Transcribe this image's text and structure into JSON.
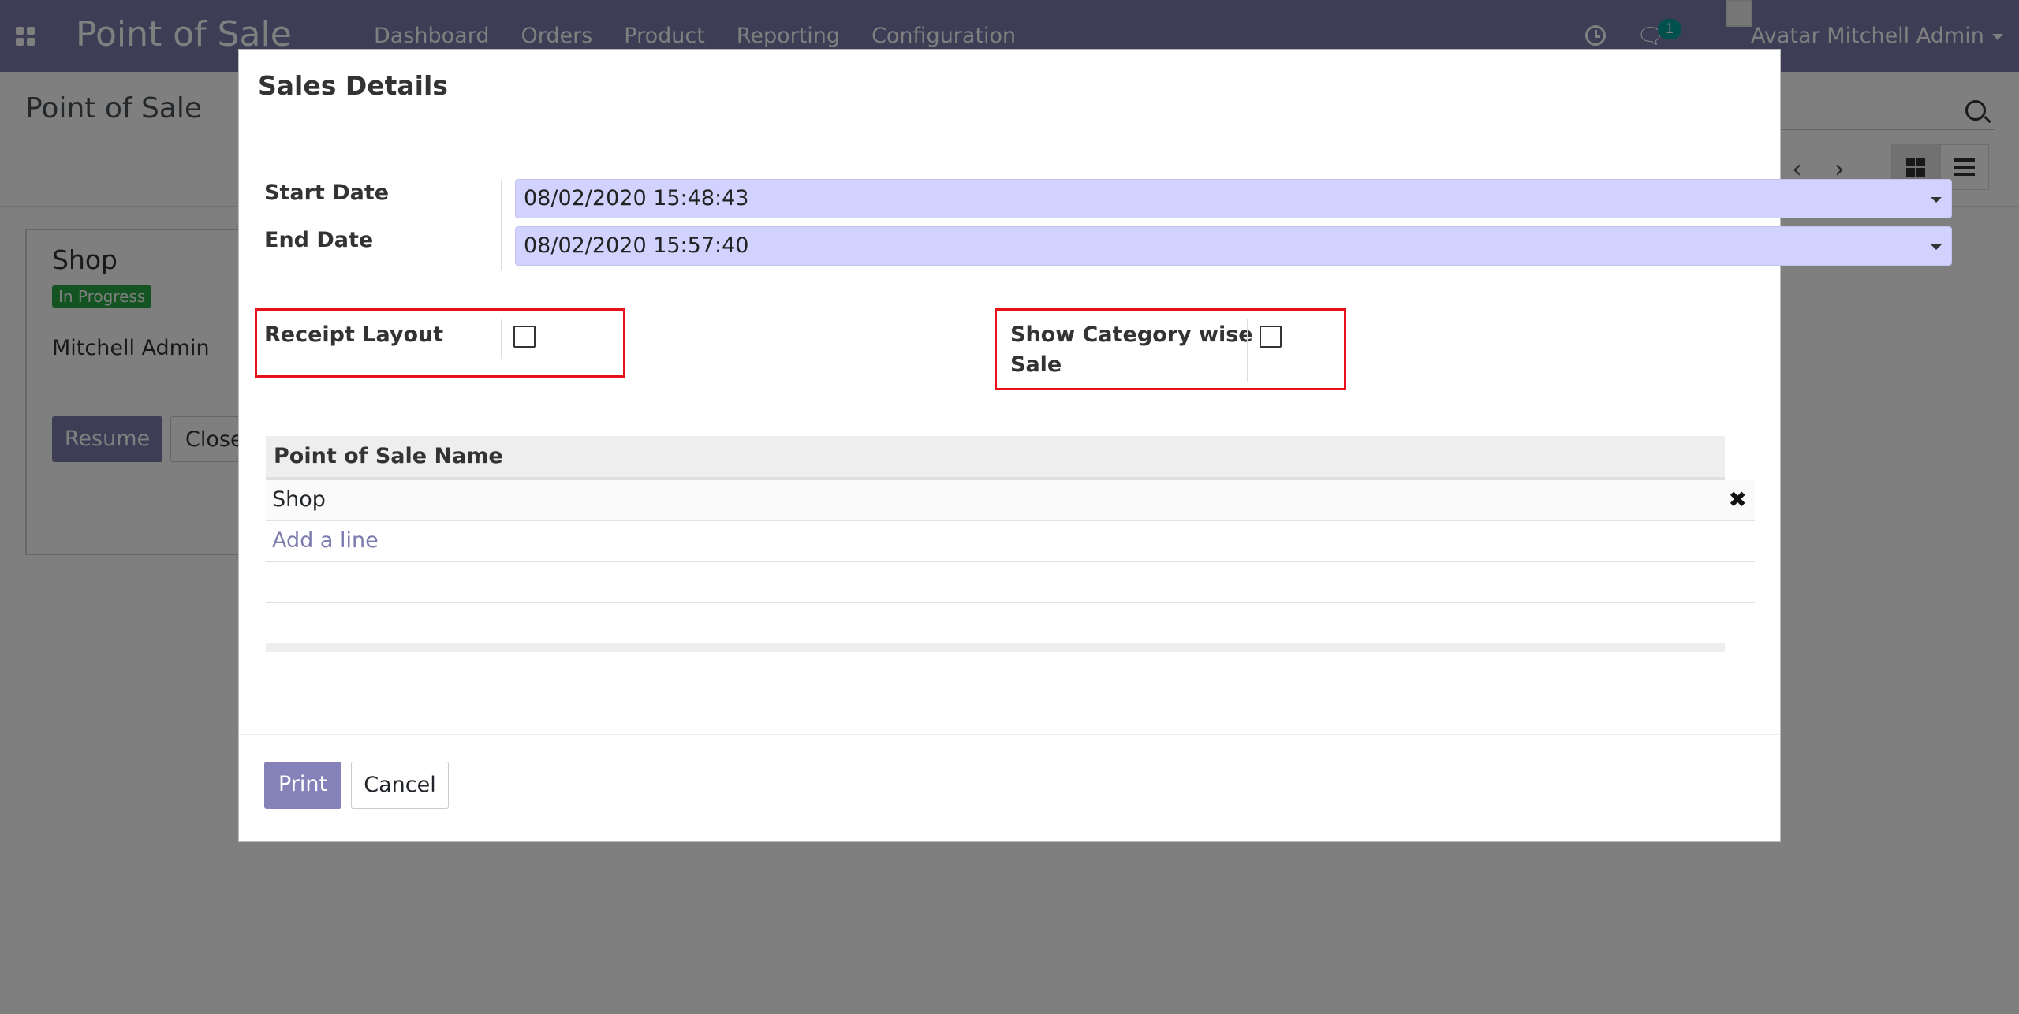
{
  "navbar": {
    "brand": "Point of Sale",
    "menu": [
      "Dashboard",
      "Orders",
      "Product",
      "Reporting",
      "Configuration"
    ],
    "chat_count": "1",
    "user": "Avatar Mitchell Admin",
    "icons": [
      "apps-icon",
      "clock-icon",
      "chat-icon",
      "avatar-image"
    ]
  },
  "control_panel": {
    "breadcrumb": "Point of Sale",
    "pager_prev": "‹",
    "pager_next": "›"
  },
  "kanban_card": {
    "title": "Shop",
    "status": "In Progress",
    "user": "Mitchell Admin",
    "resume_label": "Resume",
    "close_label": "Close"
  },
  "modal": {
    "title": "Sales Details",
    "start_date_label": "Start Date",
    "start_date_value": "08/02/2020 15:48:43",
    "end_date_label": "End Date",
    "end_date_value": "08/02/2020 15:57:40",
    "receipt_layout_label": "Receipt Layout",
    "receipt_layout_checked": false,
    "category_label_line1": "Show Category wise",
    "category_label_line2": "Sale",
    "category_checked": false,
    "table": {
      "header": "Point of Sale Name",
      "rows": [
        "Shop"
      ],
      "add_line": "Add a line",
      "delete_glyph": "✖"
    },
    "print_label": "Print",
    "cancel_label": "Cancel"
  },
  "colors": {
    "brand": "#7c7bad",
    "date_input_bg": "#d2d2ff",
    "highlight": "#e8101a",
    "badge_green": "#28a745"
  }
}
